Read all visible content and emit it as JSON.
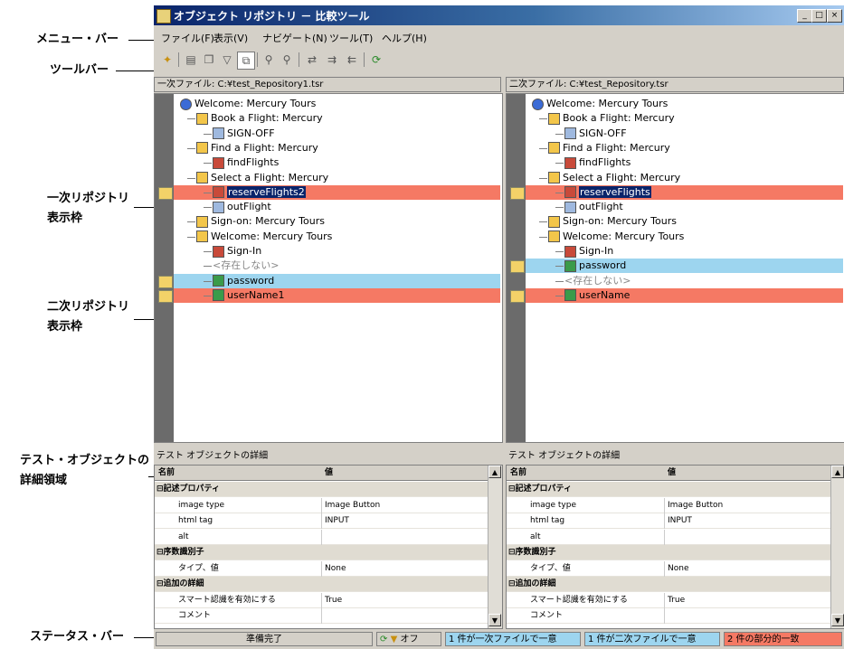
{
  "callouts": {
    "menubar": "メニュー・バー",
    "toolbar": "ツールバー",
    "primary_1": "一次リポジトリ",
    "primary_2": "表示枠",
    "secondary_1": "二次リポジトリ",
    "secondary_2": "表示枠",
    "details_1": "テスト・オブジェクトの",
    "details_2": "詳細領域",
    "statusbar": "ステータス・バー"
  },
  "window": {
    "title": "オブジェクト リポジトリ － 比較ツール",
    "minimize": "_",
    "maximize": "□",
    "close": "×"
  },
  "menu": [
    "ファイル(F)",
    "表示(V)",
    "ナビゲート(N)",
    "ツール(T)",
    "ヘルプ(H)"
  ],
  "toolbar_icons": [
    "new-icon",
    "table-icon",
    "copy-icon",
    "filter-icon",
    "compare-icon",
    "find-icon",
    "find-next-icon",
    "nav-icon",
    "nav-next-icon",
    "nav-prev-icon",
    "refresh-icon"
  ],
  "left_pane": {
    "header": "一次ファイル: C:¥test_Repository1.tsr",
    "items": [
      {
        "label": "Welcome: Mercury Tours",
        "icon": "globe"
      },
      {
        "label": "Book a Flight: Mercury",
        "icon": "page"
      },
      {
        "label": "SIGN-OFF",
        "icon": "link"
      },
      {
        "label": "Find a Flight: Mercury",
        "icon": "page"
      },
      {
        "label": "findFlights",
        "icon": "btn"
      },
      {
        "label": "Select a Flight: Mercury",
        "icon": "page"
      },
      {
        "label": "reserveFlights2",
        "icon": "btn",
        "highlight": "red",
        "selected": true
      },
      {
        "label": "outFlight",
        "icon": "link"
      },
      {
        "label": "Sign-on: Mercury Tours",
        "icon": "page"
      },
      {
        "label": "Welcome: Mercury Tours",
        "icon": "page"
      },
      {
        "label": "Sign-In",
        "icon": "btn"
      },
      {
        "label": "<存在しない>",
        "icon": "",
        "missing": true
      },
      {
        "label": "password",
        "icon": "field",
        "highlight": "blue"
      },
      {
        "label": "userName1",
        "icon": "field",
        "highlight": "red"
      }
    ]
  },
  "right_pane": {
    "header": "二次ファイル: C:¥test_Repository.tsr",
    "items": [
      {
        "label": "Welcome: Mercury Tours",
        "icon": "globe"
      },
      {
        "label": "Book a Flight: Mercury",
        "icon": "page"
      },
      {
        "label": "SIGN-OFF",
        "icon": "link"
      },
      {
        "label": "Find a Flight: Mercury",
        "icon": "page"
      },
      {
        "label": "findFlights",
        "icon": "btn"
      },
      {
        "label": "Select a Flight: Mercury",
        "icon": "page"
      },
      {
        "label": "reserveFlights",
        "icon": "btn",
        "highlight": "red",
        "selected": true
      },
      {
        "label": "outFlight",
        "icon": "link"
      },
      {
        "label": "Sign-on: Mercury Tours",
        "icon": "page"
      },
      {
        "label": "Welcome: Mercury Tours",
        "icon": "page"
      },
      {
        "label": "Sign-In",
        "icon": "btn"
      },
      {
        "label": "password",
        "icon": "field",
        "highlight": "blue"
      },
      {
        "label": "<存在しない>",
        "icon": "",
        "missing": true
      },
      {
        "label": "userName",
        "icon": "field",
        "highlight": "red"
      }
    ]
  },
  "details": {
    "title": "テスト オブジェクトの詳細",
    "col_name": "名前",
    "col_value": "値",
    "rows": [
      {
        "type": "cat",
        "name": "記述プロパティ"
      },
      {
        "type": "prop",
        "name": "image type",
        "value": "Image Button"
      },
      {
        "type": "prop",
        "name": "html tag",
        "value": "INPUT"
      },
      {
        "type": "prop",
        "name": "alt",
        "value": ""
      },
      {
        "type": "cat",
        "name": "序数識別子"
      },
      {
        "type": "prop",
        "name": "タイプ、値",
        "value": "None"
      },
      {
        "type": "cat",
        "name": "追加の詳細"
      },
      {
        "type": "prop",
        "name": "スマート認識を有効にする",
        "value": "True"
      },
      {
        "type": "prop",
        "name": "コメント",
        "value": ""
      }
    ]
  },
  "status": {
    "ready": "準備完了",
    "filter": "オフ",
    "unique_primary": "1 件が一次ファイルで一意",
    "unique_secondary": "1 件が二次ファイルで一意",
    "partial": "2 件の部分的一致",
    "colors": {
      "unique_primary": "#9dd5ef",
      "unique_secondary": "#9dd5ef",
      "partial": "#f57964"
    }
  },
  "colors": {
    "mismatch": "#f57964",
    "unique": "#9dd5ef",
    "selection": "#0a246a"
  }
}
